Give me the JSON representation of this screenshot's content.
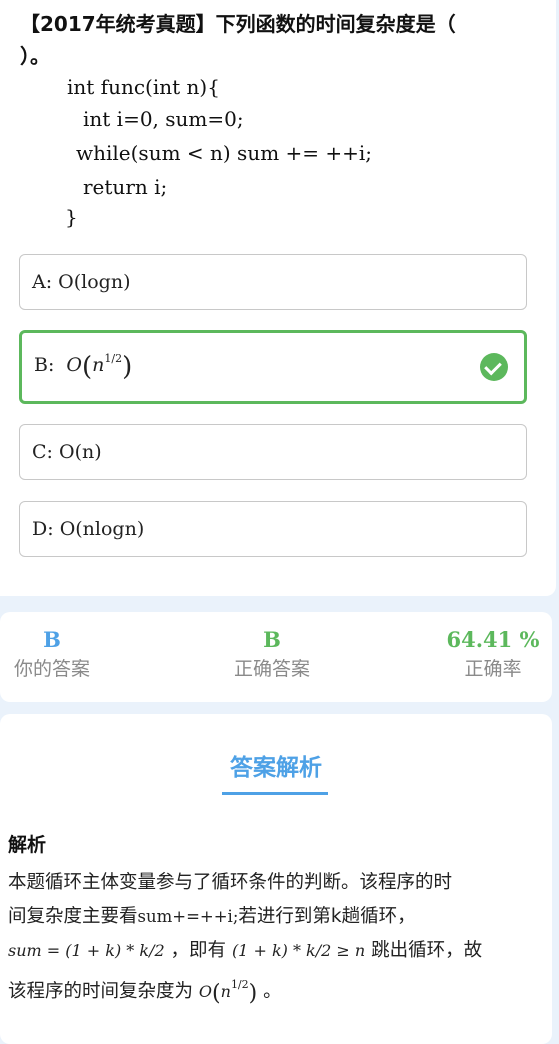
{
  "question": {
    "title_line1": "【2017年统考真题】下列函数的时间复杂度是（",
    "title_line2": "）。",
    "code_lines": [
      "int func(int n){",
      "int i=0, sum=0;",
      "while(sum < n) sum += ++i;",
      "return i;",
      "}"
    ]
  },
  "options": [
    {
      "letter": "A:",
      "text": "O(logn)",
      "correct": false
    },
    {
      "letter": "B:",
      "text": "O",
      "exponent": "1/2",
      "correct": true
    },
    {
      "letter": "C:",
      "text": "O(n)",
      "correct": false
    },
    {
      "letter": "D:",
      "text": "O(nlogn)",
      "correct": false
    }
  ],
  "stats": {
    "your_answer_value": "B",
    "your_answer_label": "你的答案",
    "correct_answer_value": "B",
    "correct_answer_label": "正确答案",
    "accuracy_value": "64.41 %",
    "accuracy_label": "正确率"
  },
  "analysis": {
    "header": "答案解析",
    "subtitle": "解析",
    "line1": "本题循环主体变量参与了循环条件的判断。该程序的时",
    "line2_a": "间复杂度主要看",
    "line2_code": "sum+=++i;",
    "line2_b": "若进行到第k趟循环，",
    "line3_math1": "sum = (1 + k) * k/2",
    "line3_mid": "，即有",
    "line3_math2": "(1 + k) * k/2 ≥ n",
    "line3_end": "跳出循环，故",
    "line4_a": "该程序的时间复杂度为",
    "line4_o": "O",
    "line4_n": "n",
    "line4_exp": "1/2",
    "line4_end": "。"
  },
  "colors": {
    "correct_green": "#5cb85c",
    "accent_blue": "#4ea1e6",
    "accuracy_green": "#5cb85c",
    "page_bg": "#eaf2fb"
  },
  "icons": [
    "check-circle-icon"
  ]
}
